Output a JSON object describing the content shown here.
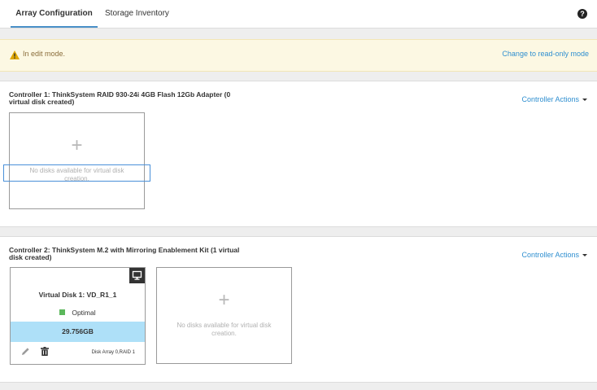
{
  "tabs": [
    {
      "label": "Array Configuration",
      "active": true
    },
    {
      "label": "Storage Inventory",
      "active": false
    }
  ],
  "help_icon": "question-circle-icon",
  "banner": {
    "icon": "warning-triangle-icon",
    "text": "In edit mode.",
    "link": "Change to read-only mode"
  },
  "controllers": [
    {
      "title": "Controller 1: ThinkSystem RAID 930-24i 4GB Flash 12Gb Adapter (0 virtual disk created)",
      "actions_label": "Controller Actions",
      "empty_card": {
        "text": "No disks available for virtual disk creation."
      }
    },
    {
      "title": "Controller 2: ThinkSystem M.2 with Mirroring Enablement Kit (1 virtual disk created)",
      "actions_label": "Controller Actions",
      "virtual_disk": {
        "name": "Virtual Disk 1: VD_R1_1",
        "status": "Optimal",
        "size": "29.756GB",
        "meta": "Disk Array 0,RAID 1"
      },
      "empty_card": {
        "text": "No disks available for virtual disk creation."
      }
    }
  ],
  "colors": {
    "accent": "#2f8fd0",
    "status_optimal": "#5cb85c",
    "size_bar": "#aee0f8",
    "banner_bg": "#fcf8e3"
  }
}
